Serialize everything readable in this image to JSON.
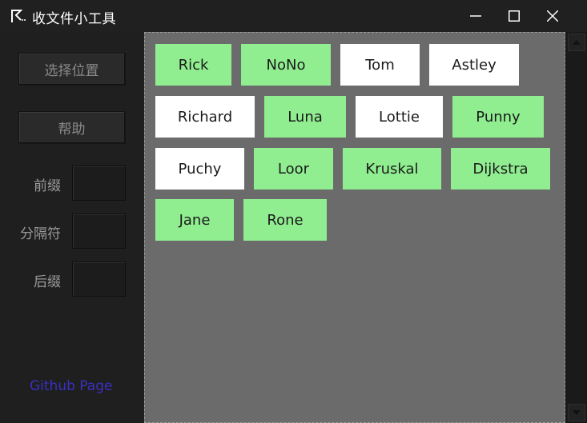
{
  "window": {
    "title": "收文件小工具",
    "icon": "app-logo-icon",
    "controls": [
      "minimize-icon",
      "maximize-icon",
      "close-icon"
    ]
  },
  "sidebar": {
    "choose_location_label": "选择位置",
    "help_label": "帮助",
    "prefix_label": "前缀",
    "prefix_value": "",
    "separator_label": "分隔符",
    "separator_value": "",
    "suffix_label": "后缀",
    "suffix_value": "",
    "github_link": "Github Page"
  },
  "colors": {
    "received": "#90ee90",
    "pending": "#ffffff",
    "panel_bg": "#6b6b6b",
    "link": "#3a2fc0"
  },
  "names": [
    {
      "label": "Rick",
      "status": "received"
    },
    {
      "label": "NoNo",
      "status": "received"
    },
    {
      "label": "Tom",
      "status": "pending"
    },
    {
      "label": "Astley",
      "status": "pending"
    },
    {
      "label": "Richard",
      "status": "pending"
    },
    {
      "label": "Luna",
      "status": "received"
    },
    {
      "label": "Lottie",
      "status": "pending"
    },
    {
      "label": "Punny",
      "status": "received"
    },
    {
      "label": "Puchy",
      "status": "pending"
    },
    {
      "label": "Loor",
      "status": "received"
    },
    {
      "label": "Kruskal",
      "status": "received"
    },
    {
      "label": "Dijkstra",
      "status": "received"
    },
    {
      "label": "Jane",
      "status": "received"
    },
    {
      "label": "Rone",
      "status": "received"
    }
  ]
}
